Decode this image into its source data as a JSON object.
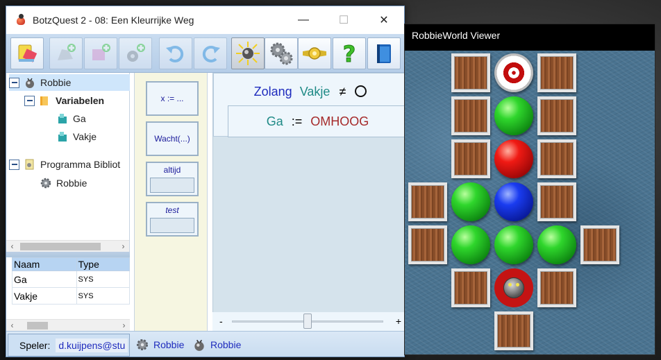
{
  "left_window": {
    "title": "BotzQuest 2 - 08: Een Kleurrijke Weg",
    "controls": {
      "minimize": "—",
      "maximize": "☐",
      "close": "✕"
    },
    "toolbar": {
      "buttons": [
        {
          "name": "eraser",
          "state": "normal"
        },
        {
          "name": "add-robot",
          "state": "disabled"
        },
        {
          "name": "add-variable",
          "state": "disabled"
        },
        {
          "name": "add-program",
          "state": "disabled"
        },
        {
          "name": "undo",
          "state": "disabled"
        },
        {
          "name": "redo",
          "state": "disabled"
        },
        {
          "name": "run",
          "state": "active"
        },
        {
          "name": "gears",
          "state": "normal"
        },
        {
          "name": "badge",
          "state": "normal"
        },
        {
          "name": "help",
          "state": "normal"
        },
        {
          "name": "book",
          "state": "normal"
        }
      ]
    },
    "tree": {
      "root": "Robbie",
      "variables_label": "Variabelen",
      "variables": [
        "Ga",
        "Vakje"
      ],
      "library_label": "Programma Bibliot",
      "library_items": [
        "Robbie"
      ]
    },
    "table": {
      "headers": [
        "Naam",
        "Type"
      ],
      "rows": [
        [
          "Ga",
          "SYS"
        ],
        [
          "Vakje",
          "SYS"
        ]
      ]
    },
    "palette": {
      "assign": "x := ...",
      "wait": "Wacht(...)",
      "always": "altijd",
      "test": "test"
    },
    "editor": {
      "while_keyword": "Zolang",
      "while_var": "Vakje",
      "op": "≠",
      "assign_var": "Ga",
      "assign_op": ":=",
      "assign_value": "OMHOOG"
    },
    "slider": {
      "minus": "-",
      "plus": "+",
      "value": 0.5
    },
    "status": {
      "player_label": "Speler:",
      "player": "d.kuijpens@stu",
      "item1": "Robbie",
      "item2": "Robbie"
    }
  },
  "right_window": {
    "title": "RobbieWorld Viewer"
  }
}
